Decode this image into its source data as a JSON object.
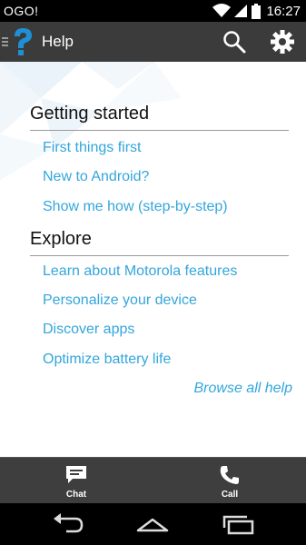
{
  "status_bar": {
    "carrier": "OGO!",
    "time": "16:27"
  },
  "action_bar": {
    "title": "Help"
  },
  "sections": [
    {
      "header": "Getting started",
      "links": [
        "First things first",
        "New to Android?",
        "Show me how (step-by-step)"
      ]
    },
    {
      "header": "Explore",
      "links": [
        "Learn about Motorola features",
        "Personalize your device",
        "Discover apps",
        "Optimize battery life"
      ]
    }
  ],
  "browse_all": "Browse all help",
  "bottom_bar": {
    "chat_label": "Chat",
    "call_label": "Call"
  },
  "colors": {
    "link": "#33a6dc",
    "action_bar": "#3b3b3b",
    "bottom_bar": "#3e3e3e",
    "help_icon": "#1f8fd6"
  },
  "icons": {
    "status": [
      "wifi-icon",
      "signal-icon",
      "battery-icon"
    ],
    "action_bar": [
      "help-app-icon",
      "search-icon",
      "gear-icon"
    ],
    "bottom_bar": [
      "chat-icon",
      "phone-icon"
    ],
    "nav": [
      "back-icon",
      "home-icon",
      "recent-apps-icon"
    ]
  }
}
